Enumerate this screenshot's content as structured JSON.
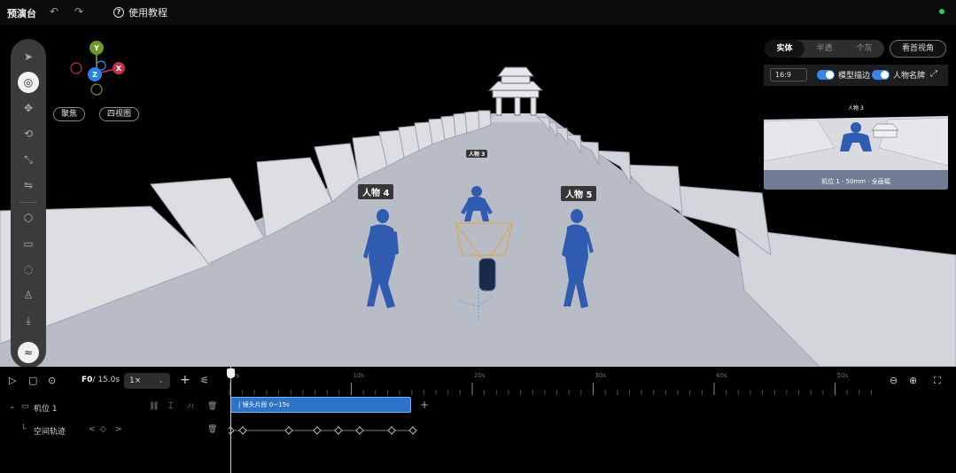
{
  "app": {
    "title": "预演台",
    "tutorial_label": "使用教程",
    "help_glyph": "?",
    "undo_glyph": "↶",
    "redo_glyph": "↷"
  },
  "toolbar": {
    "tools": [
      {
        "icon": "select-arrow-icon",
        "glyph": "➤"
      },
      {
        "icon": "orbit-camera-icon",
        "glyph": "◎"
      },
      {
        "icon": "move-icon",
        "glyph": "✥"
      },
      {
        "icon": "rotate-icon",
        "glyph": "⟲"
      },
      {
        "icon": "scale-icon",
        "glyph": "⤡"
      },
      {
        "icon": "mirror-icon",
        "glyph": "⇋"
      },
      {
        "icon": "cube-icon",
        "glyph": "⬡"
      },
      {
        "icon": "camera-icon",
        "glyph": "▭"
      },
      {
        "icon": "light-icon",
        "glyph": "◌"
      },
      {
        "icon": "character-icon",
        "glyph": "♙"
      },
      {
        "icon": "import-icon",
        "glyph": "⤓"
      },
      {
        "icon": "settings-icon",
        "glyph": "≈"
      }
    ]
  },
  "gizmo": {
    "y": "Y",
    "x": "X",
    "z": "Z",
    "focus_btn": "聚焦",
    "quad_btn": "四视图"
  },
  "scene": {
    "labels": {
      "char4": "人物 4",
      "char5": "人物 5",
      "char3": "人物 3"
    }
  },
  "right_panel": {
    "modes": [
      "实体",
      "半透",
      "个灰"
    ],
    "active_mode": "实体",
    "view_select": "看首视角",
    "aspect": "16:9",
    "toggle1": "模型描边",
    "toggle2": "人物名牌",
    "expand_glyph": "⤢",
    "preview_label": "人物 3",
    "preview_footer": "机位 1 · 50mm · 全画幅"
  },
  "timeline": {
    "frame": "F0",
    "duration": "/ 15.0s",
    "speed": "1×",
    "add": "+",
    "ticks": [
      "0s",
      "10s",
      "20s",
      "30s",
      "40s",
      "50s"
    ],
    "track1_name": "机位 1",
    "track2_name": "空间轨迹",
    "clip_label": "| 镜头片段 0~15s",
    "kf_prev": "<",
    "kf_diamond": "◇",
    "kf_next": ">"
  }
}
